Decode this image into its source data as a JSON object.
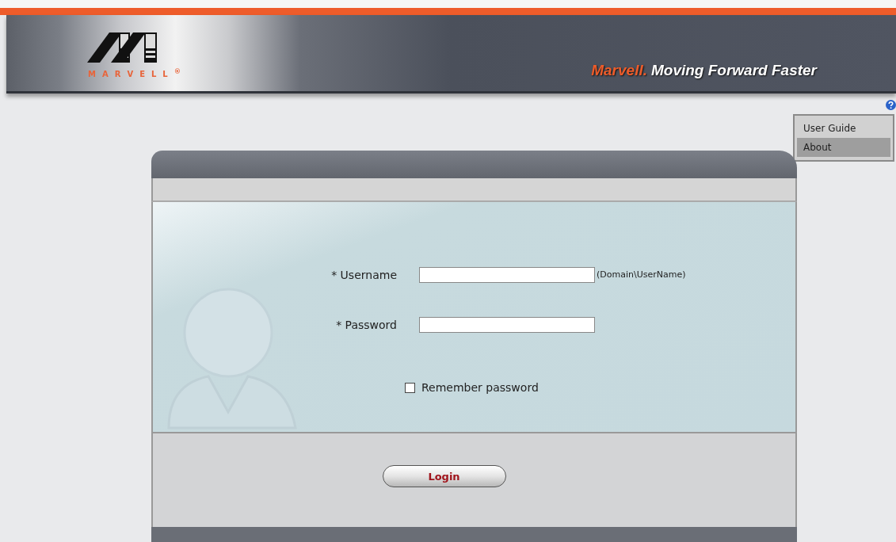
{
  "header": {
    "logo_text": "MARVELL$^{®}$",
    "brand": "Marvell.",
    "tagline": "Moving Forward Faster"
  },
  "help_menu": {
    "items": [
      {
        "label": "User Guide",
        "selected": false
      },
      {
        "label": "About",
        "selected": true
      }
    ]
  },
  "login_form": {
    "username": {
      "label": "* Username",
      "hint": "(Domain\\UserName)"
    },
    "password": {
      "label": "* Password"
    },
    "remember": {
      "label": "Remember password",
      "checked": false
    },
    "button": "Login"
  }
}
